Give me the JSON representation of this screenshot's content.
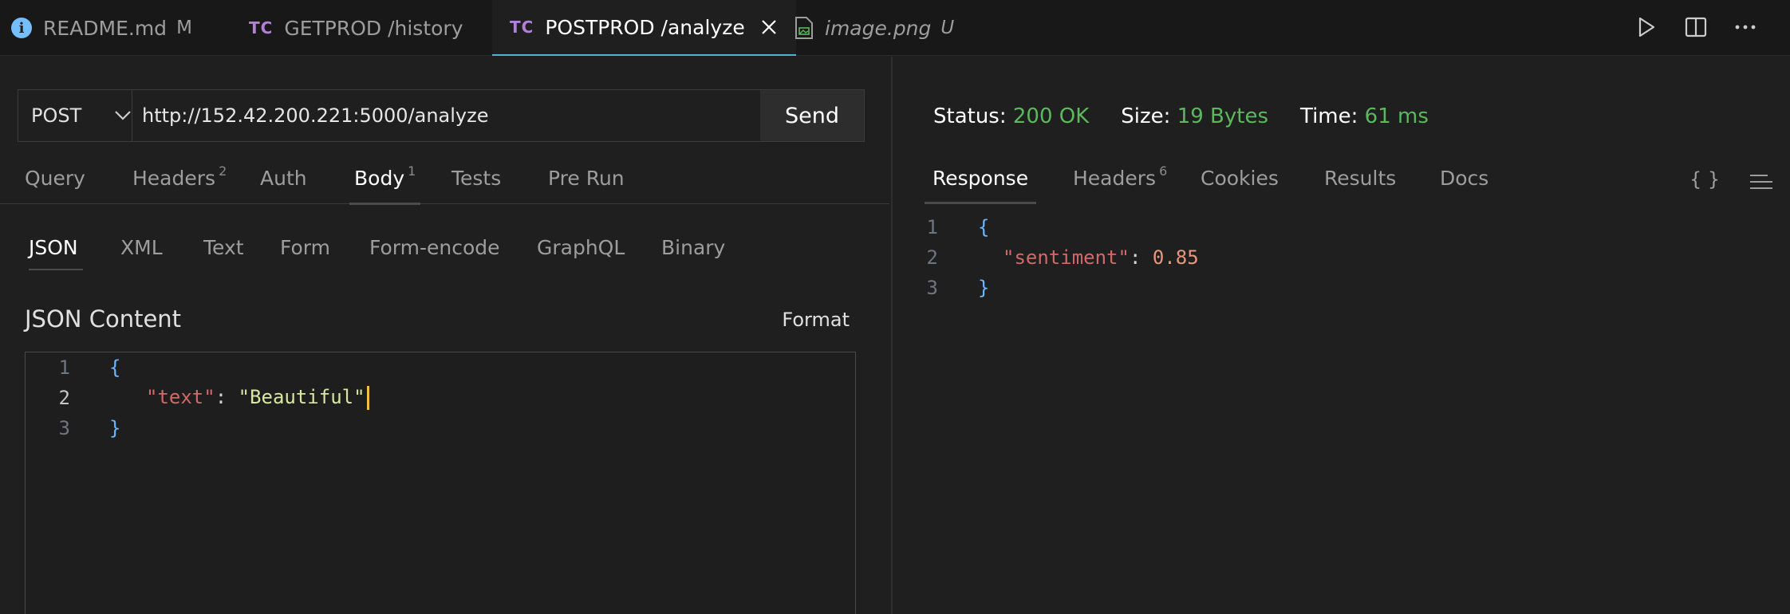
{
  "tabs": [
    {
      "label": "README.md",
      "badge": "M",
      "icon": "info-icon",
      "active": false
    },
    {
      "label": "GETPROD /history",
      "icon": "tc-icon",
      "active": false
    },
    {
      "label": "POSTPROD /analyze",
      "icon": "tc-icon",
      "active": true
    },
    {
      "label": "image.png",
      "badge": "U",
      "icon": "image-file-icon",
      "active": false
    }
  ],
  "tab_icon_text": "TC",
  "titlebar_actions": [
    "run-icon",
    "split-editor-icon",
    "more-icon"
  ],
  "request": {
    "method": "POST",
    "url": "http://152.42.200.221:5000/analyze",
    "send_label": "Send"
  },
  "request_tabs": {
    "query": "Query",
    "headers": "Headers",
    "headers_count": "2",
    "auth": "Auth",
    "body": "Body",
    "body_count": "1",
    "tests": "Tests",
    "pre_run": "Pre Run"
  },
  "body_tabs": [
    "JSON",
    "XML",
    "Text",
    "Form",
    "Form-encode",
    "GraphQL",
    "Binary"
  ],
  "json_content": {
    "title": "JSON Content",
    "format_label": "Format",
    "line_numbers": [
      "1",
      "2",
      "3"
    ],
    "open_brace": "{",
    "key": "\"text\"",
    "colon": ": ",
    "value": "\"Beautiful\"",
    "close_brace": "}"
  },
  "response_status": {
    "status_label": "Status:",
    "status_value": "200 OK",
    "size_label": "Size:",
    "size_value": "19 Bytes",
    "time_label": "Time:",
    "time_value": "61 ms"
  },
  "response_tabs": {
    "response": "Response",
    "headers": "Headers",
    "headers_count": "6",
    "cookies": "Cookies",
    "results": "Results",
    "docs": "Docs",
    "braces_tool": "{ }"
  },
  "response_body": {
    "line_numbers": [
      "1",
      "2",
      "3"
    ],
    "open_brace": "{",
    "key": "\"sentiment\"",
    "colon": ": ",
    "value": "0.85",
    "close_brace": "}"
  },
  "colors": {
    "accent_tab_underline": "#4fb3d9",
    "status_green": "#5cb85c",
    "json_key": "#d16969",
    "json_string": "#d7e7a3",
    "json_number": "#e8977a",
    "json_brace": "#6cb6ff",
    "cursor": "#f0c040"
  }
}
